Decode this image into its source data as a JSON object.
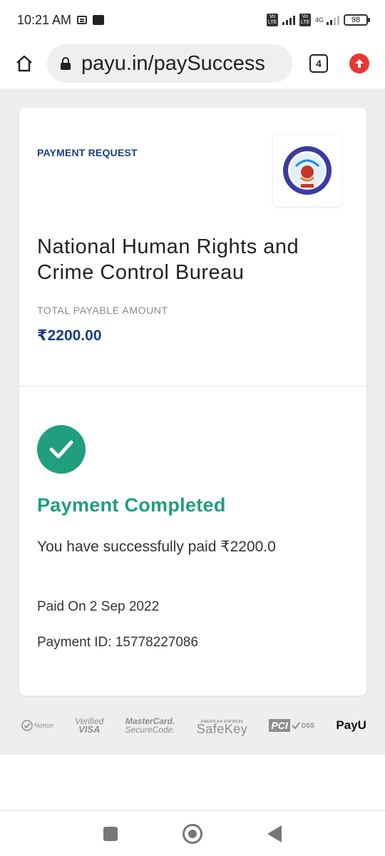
{
  "status_bar": {
    "time": "10:21 AM",
    "battery": "98",
    "network": "4G",
    "volte_1": "Vo LTE",
    "volte_2": "Vo LTE"
  },
  "browser": {
    "url": "payu.in/paySuccess",
    "tab_count": "4"
  },
  "payment": {
    "header_label": "PAYMENT REQUEST",
    "merchant_name": "National Human Rights and Crime Control Bureau",
    "amount_label": "TOTAL PAYABLE AMOUNT",
    "amount": "₹2200.00"
  },
  "result": {
    "title": "Payment Completed",
    "message": "You have successfully paid ₹2200.0",
    "paid_on": "Paid On 2 Sep 2022",
    "payment_id": "Payment ID: 15778227086"
  },
  "trust_badges": {
    "norton": "Norton",
    "visa_line1": "Verified",
    "visa_line2": "VISA",
    "mc_line1": "MasterCard.",
    "mc_line2": "SecureCode.",
    "amex_top": "AMERICAN EXPRESS",
    "amex_main": "SafeKey",
    "pci": "PCI",
    "dss": "DSS",
    "payu": "PayU"
  },
  "colors": {
    "success_green": "#209e7d",
    "brand_blue": "#1a3f7a",
    "update_red": "#e53935"
  }
}
